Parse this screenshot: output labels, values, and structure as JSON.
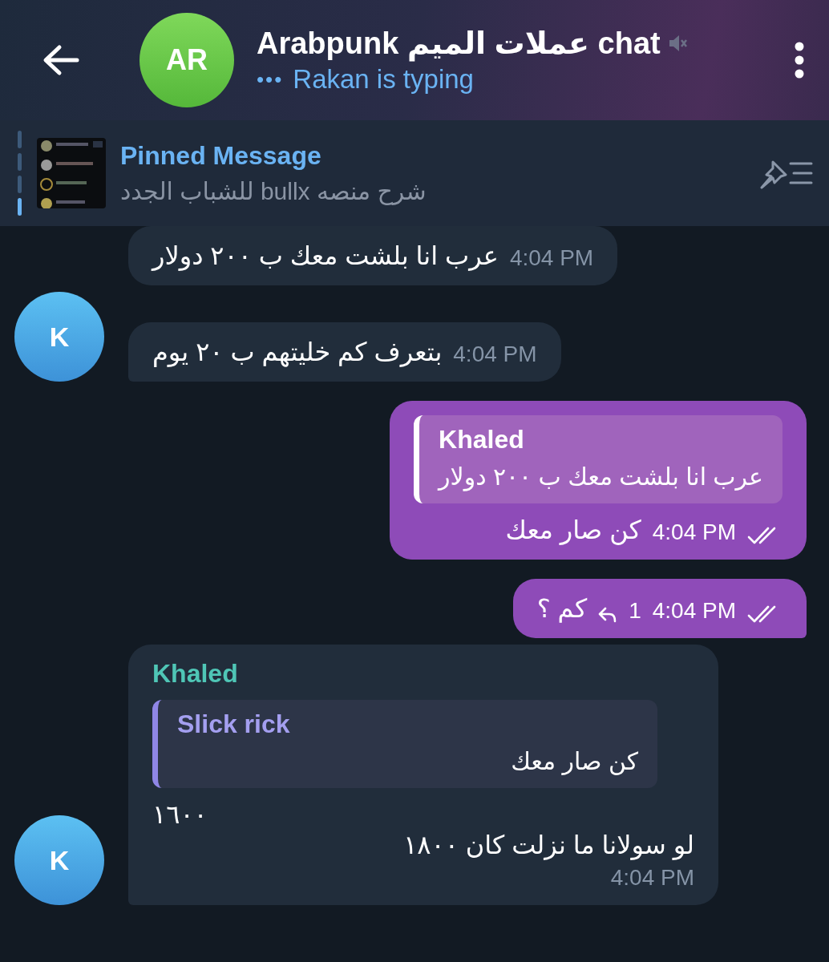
{
  "header": {
    "avatar": "AR",
    "title": "Arabpunk عملات الميم chat",
    "muted": true,
    "typing_dots": "•••",
    "status": "Rakan is typing"
  },
  "pinned": {
    "title": "Pinned Message",
    "text": "شرح منصه bullx للشباب الجدد"
  },
  "messages": [
    {
      "kind": "incoming",
      "lines": [
        "عرب انا بلشت معك ب ٢٠٠ دولار"
      ],
      "time": "4:04 PM"
    },
    {
      "kind": "incoming",
      "avatar": "K",
      "lines": [
        "بتعرف كم خليتهم ب ٢٠ يوم"
      ],
      "time": "4:04 PM"
    },
    {
      "kind": "outgoing",
      "reply": {
        "name": "Khaled",
        "text": "عرب انا بلشت معك ب ٢٠٠ دولار"
      },
      "lines": [
        "كن صار معك"
      ],
      "time": "4:04 PM",
      "read": true
    },
    {
      "kind": "outgoing",
      "lines": [
        "كم ؟"
      ],
      "replies": "1",
      "time": "4:04 PM",
      "read": true
    },
    {
      "kind": "incoming",
      "avatar": "K",
      "sender": "Khaled",
      "reply": {
        "name": "Slick rick",
        "text": "كن صار معك"
      },
      "lines": [
        "١٦٠٠",
        "لو سولانا ما نزلت كان ١٨٠٠"
      ],
      "time": "4:04 PM",
      "time_below": true
    }
  ]
}
